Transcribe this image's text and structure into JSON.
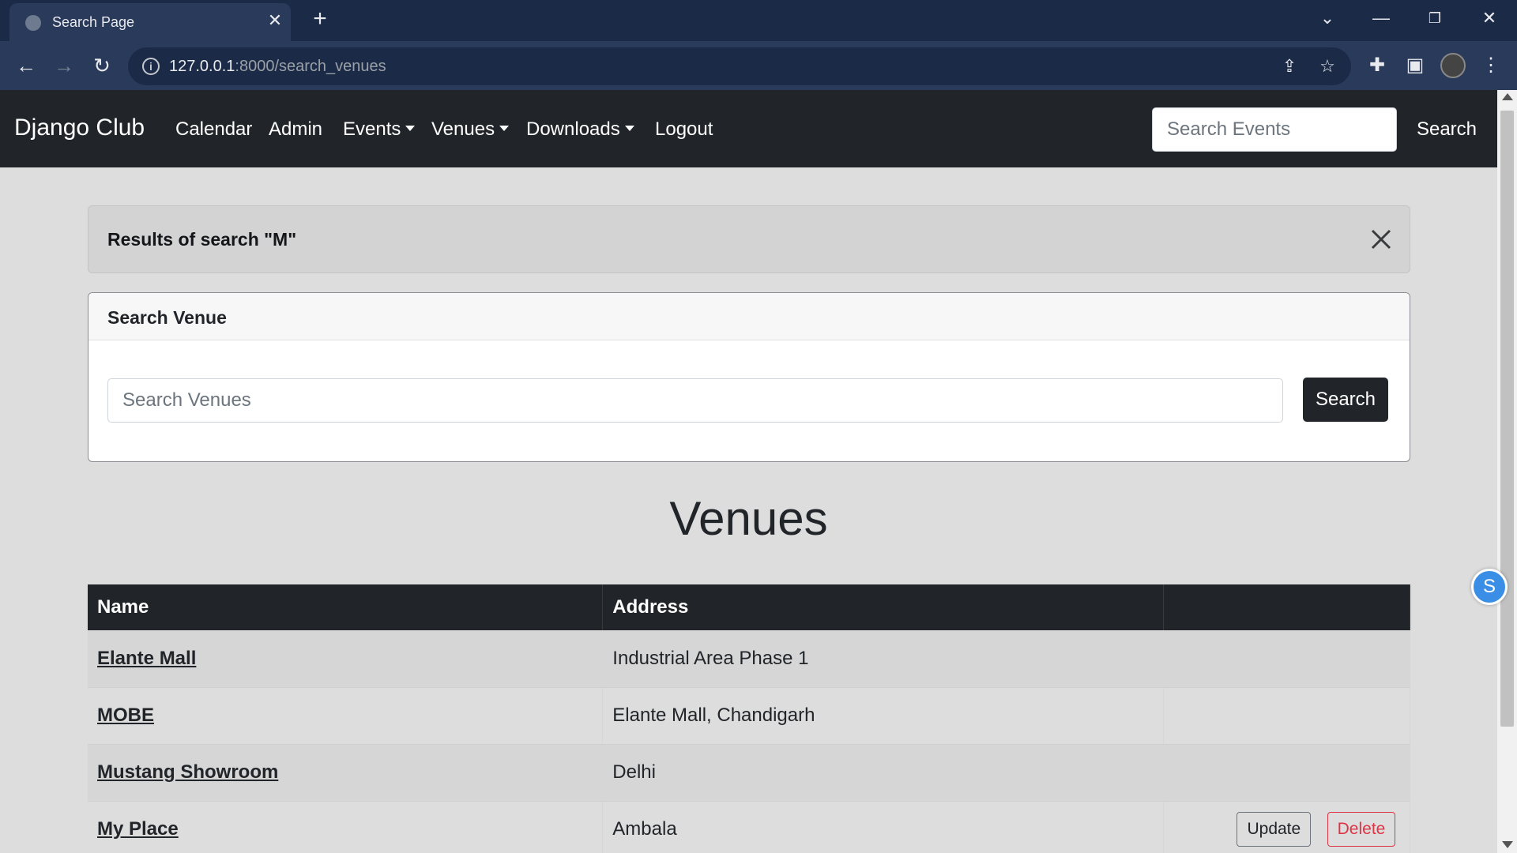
{
  "browser": {
    "tab_title": "Search Page",
    "url_host": "127.0.0.1",
    "url_rest": ":8000/search_venues",
    "icons": [
      "globe-icon",
      "close-icon",
      "plus-icon",
      "chevron-down-icon",
      "minimize-icon",
      "restore-icon",
      "close-window-icon",
      "back-icon",
      "forward-icon",
      "reload-icon",
      "info-icon",
      "share-icon",
      "star-icon",
      "extensions-icon",
      "sidepanel-icon",
      "profile-avatar",
      "more-icon"
    ]
  },
  "navbar": {
    "brand": "Django Club",
    "items": {
      "calendar": "Calendar",
      "admin": "Admin",
      "events": "Events",
      "venues": "Venues",
      "downloads": "Downloads",
      "logout": "Logout"
    },
    "search_placeholder": "Search Events",
    "search_button": "Search"
  },
  "alert": {
    "message": "Results of search \"M\""
  },
  "search_card": {
    "title": "Search Venue",
    "input_placeholder": "Search Venues",
    "button": "Search"
  },
  "heading": "Venues",
  "table": {
    "headers": {
      "name": "Name",
      "address": "Address",
      "actions": ""
    },
    "rows": [
      {
        "name": "Elante Mall",
        "address": "Industrial Area Phase 1"
      },
      {
        "name": "MOBE",
        "address": "Elante Mall, Chandigarh"
      },
      {
        "name": "Mustang Showroom",
        "address": "Delhi"
      },
      {
        "name": "My Place",
        "address": "Ambala",
        "update": "Update",
        "delete": "Delete"
      }
    ]
  },
  "side_widget": "S",
  "colors": {
    "navbar_bg": "#212529",
    "page_bg": "#dedddd",
    "delete_red": "#dc3545",
    "chrome_bg": "#1b2a47"
  }
}
